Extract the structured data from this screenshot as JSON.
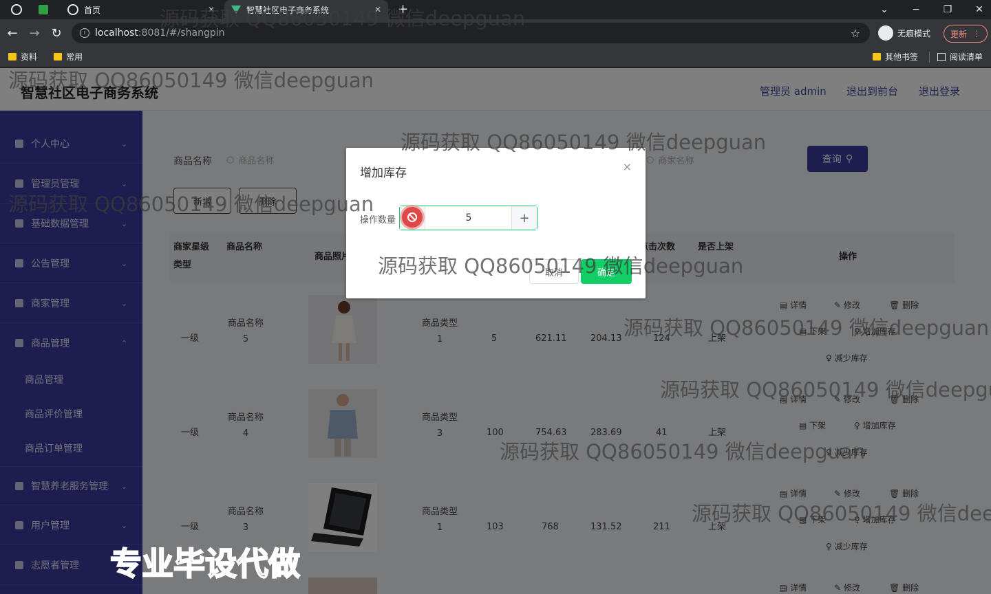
{
  "browser": {
    "tabs": [
      {
        "title": "首页",
        "close": "✕"
      },
      {
        "title": "智慧社区电子商务系统",
        "close": "✕"
      }
    ],
    "new_tab": "+",
    "window": {
      "minimize": "−",
      "restore": "❐",
      "close": "✕",
      "tab_search": "⌄"
    },
    "nav": {
      "back": "←",
      "forward": "→",
      "reload": "↻"
    },
    "url": {
      "host": "localhost",
      "rest": ":8081/#/shangpin"
    },
    "bookmark_star": "☆",
    "profile": {
      "label": "无痕模式"
    },
    "update": {
      "label": "更新",
      "menu": "⋮"
    },
    "bookmarks": [
      {
        "label": "资料"
      },
      {
        "label": "常用"
      },
      {
        "label": "其他书签"
      },
      {
        "label": "阅读清单"
      }
    ]
  },
  "header": {
    "title": "智慧社区电子商务系统",
    "admin": "管理员 admin",
    "to_front": "退出到前台",
    "logout": "退出登录"
  },
  "sidebar": {
    "chevron_down": "⌄",
    "chevron_up": "⌃",
    "items": [
      {
        "label": "个人中心"
      },
      {
        "label": "管理员管理"
      },
      {
        "label": "基础数据管理"
      },
      {
        "label": "公告管理"
      },
      {
        "label": "商家管理"
      },
      {
        "label": "商品管理"
      },
      {
        "label": "智慧养老服务管理"
      },
      {
        "label": "用户管理"
      },
      {
        "label": "志愿者管理"
      }
    ],
    "sub_items": [
      {
        "label": "商品管理"
      },
      {
        "label": "商品评价管理"
      },
      {
        "label": "商品订单管理"
      }
    ]
  },
  "search": {
    "name_label": "商品名称",
    "name_placeholder": "商品名称",
    "merchant_placeholder": "商家名称",
    "query_button": "查询"
  },
  "actions": {
    "add": "新增",
    "delete": "删除"
  },
  "table": {
    "headers": {
      "merchant_level": "商家星级",
      "type": "类型",
      "name": "商品名称",
      "photo": "商品照片",
      "clicks": "点击次数",
      "on_shelf": "是否上架",
      "ops": "操作"
    },
    "rows": [
      {
        "level": "一级",
        "name": "商品名称",
        "name_no": "5",
        "type": "商品类型",
        "type_no": "1",
        "stock": "5",
        "price": "621.11",
        "vip_price": "204.13",
        "clicks": "124",
        "shelf": "上架",
        "shelf_action": "下架",
        "image": "dress"
      },
      {
        "level": "一级",
        "name": "商品名称",
        "name_no": "4",
        "type": "商品类型",
        "type_no": "3",
        "stock": "100",
        "price": "754.63",
        "vip_price": "283.69",
        "clicks": "41",
        "shelf": "上架",
        "shelf_action": "下架",
        "image": "shirt"
      },
      {
        "level": "一级",
        "name": "商品名称",
        "name_no": "3",
        "type": "商品类型",
        "type_no": "1",
        "stock": "103",
        "price": "768",
        "vip_price": "131.52",
        "clicks": "211",
        "shelf": "上架",
        "shelf_action": "下架",
        "image": "laptop"
      }
    ],
    "op_labels": {
      "detail": "详情",
      "edit": "修改",
      "delete": "删除",
      "add_stock": "增加库存",
      "reduce_stock": "减少库存"
    },
    "row4_ops": [
      "详情",
      "修改",
      "删除"
    ]
  },
  "dialog": {
    "title": "增加库存",
    "close": "×",
    "field_label": "操作数量",
    "value": "5",
    "plus": "+",
    "cancel": "取消",
    "confirm": "确定"
  },
  "watermark": "源码获取 QQ86050149 微信deepguan",
  "badge": "专业毕设代做"
}
